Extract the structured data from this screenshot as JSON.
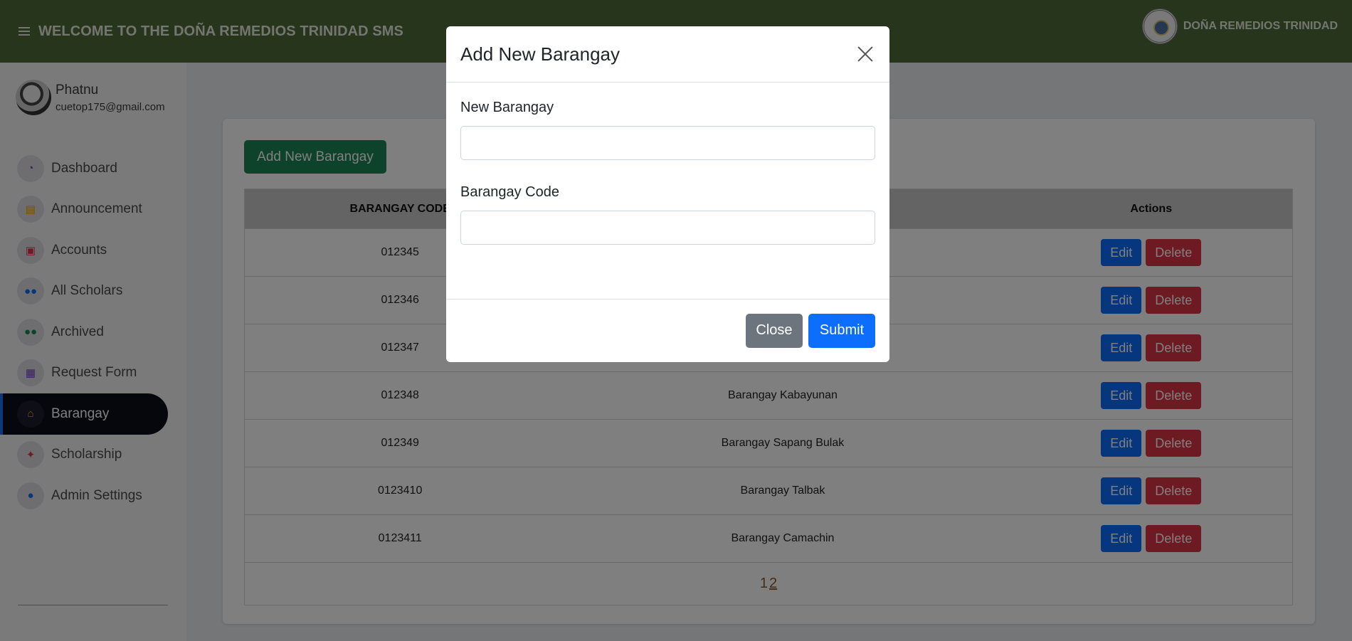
{
  "header": {
    "title": "WELCOME TO THE DOÑA REMEDIOS TRINIDAD SMS",
    "brand_name": "DOÑA REMEDIOS TRINIDAD"
  },
  "profile": {
    "name": "Phatnu",
    "email": "cuetop175@gmail.com"
  },
  "sidebar": {
    "items": [
      {
        "label": "Dashboard",
        "icon": "dashboard-gauge-icon",
        "color": "#6f42c1"
      },
      {
        "label": "Announcement",
        "icon": "announcement-icon",
        "color": "#f0a500"
      },
      {
        "label": "Accounts",
        "icon": "accounts-card-icon",
        "color": "#dc3545"
      },
      {
        "label": "All Scholars",
        "icon": "people-icon",
        "color": "#0d6efd"
      },
      {
        "label": "Archived",
        "icon": "people-archive-icon",
        "color": "#198754"
      },
      {
        "label": "Request Form",
        "icon": "request-form-icon",
        "color": "#6f42c1"
      },
      {
        "label": "Barangay",
        "icon": "barangay-icon",
        "color": "#f5a623",
        "active": true
      },
      {
        "label": "Scholarship",
        "icon": "scholarship-icon",
        "color": "#dc3545"
      },
      {
        "label": "Admin Settings",
        "icon": "admin-user-icon",
        "color": "#0d6efd"
      }
    ]
  },
  "main": {
    "add_button": "Add New Barangay",
    "table": {
      "headers": [
        "BARANGAY CODE",
        "",
        "Actions"
      ],
      "rows": [
        {
          "code": "012345",
          "name": ""
        },
        {
          "code": "012346",
          "name": ""
        },
        {
          "code": "012347",
          "name": ""
        },
        {
          "code": "012348",
          "name": "Barangay Kabayunan"
        },
        {
          "code": "012349",
          "name": "Barangay Sapang Bulak"
        },
        {
          "code": "0123410",
          "name": "Barangay Talbak"
        },
        {
          "code": "0123411",
          "name": "Barangay Camachin"
        }
      ],
      "edit_label": "Edit",
      "delete_label": "Delete"
    },
    "pagination": {
      "page1": "1",
      "page2": "2"
    }
  },
  "modal": {
    "title": "Add New Barangay",
    "field1_label": "New Barangay",
    "field1_value": "",
    "field2_label": "Barangay Code",
    "field2_value": "",
    "close_label": "Close",
    "submit_label": "Submit"
  }
}
